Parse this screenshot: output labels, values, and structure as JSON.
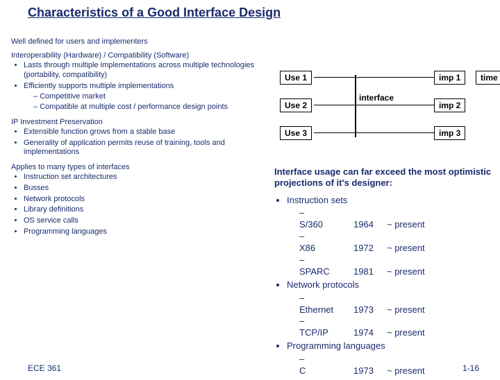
{
  "title": "Characteristics of a Good Interface Design",
  "left": {
    "line1": "Well defined for users and implementers",
    "line2": "Interoperability (Hardware) / Compatibility (Software)",
    "b1": "Lasts through multiple implementations across multiple technologies (portability, compatibility)",
    "b2": "Efficiently supports multiple implementations",
    "b2a": "Competitive market",
    "b2b": "Compatible at multiple cost / performance design points",
    "sec2": "IP Investment Preservation",
    "s2b1": "Extensible function grows from a stable base",
    "s2b2": "Generality of application permits reuse of training, tools and implementations",
    "sec3": "Applies to many types of interfaces",
    "s3b1": "Instruction set architectures",
    "s3b2": "Busses",
    "s3b3": "Network protocols",
    "s3b4": "Library definitions",
    "s3b5": "OS service calls",
    "s3b6": "Programming languages"
  },
  "diagram": {
    "use1": "Use 1",
    "use2": "Use 2",
    "use3": "Use 3",
    "interface": "interface",
    "imp1": "imp 1",
    "imp2": "imp 2",
    "imp3": "imp 3",
    "time": "time"
  },
  "right_text": "Interface usage can far exceed the most optimistic projections of it's designer:",
  "right_list": {
    "h1": "Instruction sets",
    "r1a_n": "S/360",
    "r1a_y": "1964",
    "r1a_p": "~ present",
    "r1b_n": "X86",
    "r1b_y": "1972",
    "r1b_p": "~ present",
    "r1c_n": "SPARC",
    "r1c_y": "1981",
    "r1c_p": "~ present",
    "h2": "Network protocols",
    "r2a_n": "Ethernet",
    "r2a_y": "1973",
    "r2a_p": "~ present",
    "r2b_n": "TCP/IP",
    "r2b_y": "1974",
    "r2b_p": "~ present",
    "h3": "Programming languages",
    "r3a_n": "C",
    "r3a_y": "1973",
    "r3a_p": "~ present"
  },
  "footer": {
    "left": "ECE 361",
    "right": "1-16"
  }
}
